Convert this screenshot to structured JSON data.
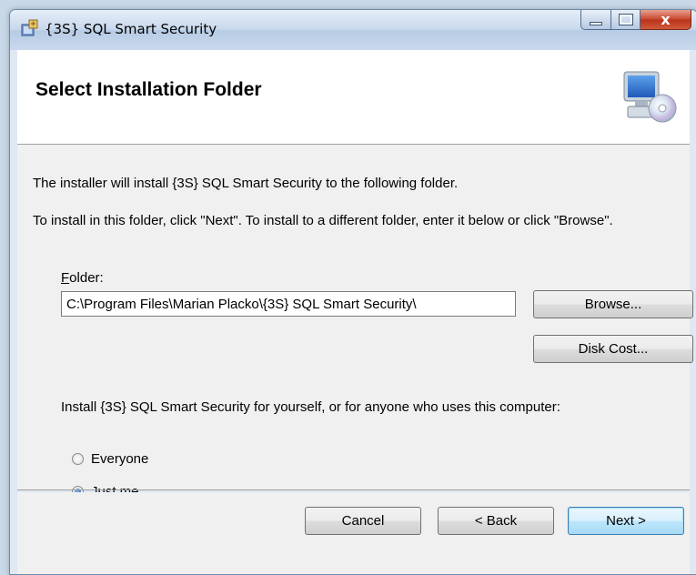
{
  "window": {
    "title": "{3S} SQL Smart Security",
    "close_glyph": "x"
  },
  "banner": {
    "title": "Select Installation Folder",
    "icon": "computer-cd-icon"
  },
  "content": {
    "line1": "The installer will install {3S} SQL Smart Security to the following folder.",
    "line2": "To install in this folder, click \"Next\". To install to a different folder, enter it below or click \"Browse\".",
    "folder_label": "Folder:",
    "folder_value": "C:\\Program Files\\Marian Placko\\{3S} SQL Smart Security\\",
    "browse_label": "Browse...",
    "disk_cost_label": "Disk Cost...",
    "install_for_text": "Install {3S} SQL Smart Security for yourself, or for anyone who uses this computer:",
    "radio_everyone": "Everyone",
    "radio_just_me": "Just me",
    "selected_option": "Just me"
  },
  "footer": {
    "cancel_label": "Cancel",
    "back_label": "< Back",
    "next_label": "Next >"
  }
}
